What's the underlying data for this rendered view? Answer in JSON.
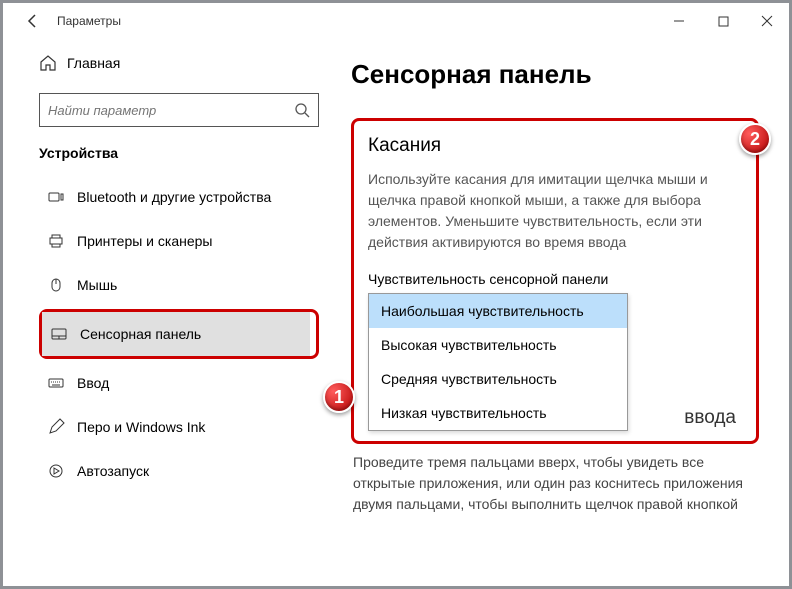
{
  "window": {
    "title": "Параметры"
  },
  "sidebar": {
    "home": "Главная",
    "search_placeholder": "Найти параметр",
    "category": "Устройства",
    "items": [
      {
        "label": "Bluetooth и другие устройства",
        "icon": "bluetooth-icon"
      },
      {
        "label": "Принтеры и сканеры",
        "icon": "printer-icon"
      },
      {
        "label": "Мышь",
        "icon": "mouse-icon"
      },
      {
        "label": "Сенсорная панель",
        "icon": "touchpad-icon"
      },
      {
        "label": "Ввод",
        "icon": "keyboard-icon"
      },
      {
        "label": "Перо и Windows Ink",
        "icon": "pen-icon"
      },
      {
        "label": "Автозапуск",
        "icon": "autoplay-icon"
      }
    ]
  },
  "main": {
    "page_title": "Сенсорная панель",
    "section_title": "Касания",
    "description": "Используйте касания для имитации щелчка мыши и щелчка правой кнопкой мыши, а также для выбора элементов. Уменьшите чувствительность, если эти действия активируются во время ввода",
    "dropdown_label": "Чувствительность сенсорной панели",
    "dropdown_options": [
      "Наибольшая чувствительность",
      "Высокая чувствительность",
      "Средняя чувствительность",
      "Низкая чувствительность"
    ],
    "after_section_frag": "ввода",
    "after_text": "Проведите тремя пальцами вверх, чтобы увидеть все открытые приложения, или один раз коснитесь приложения двумя пальцами, чтобы выполнить щелчок правой кнопкой"
  },
  "annotations": {
    "badge1": "1",
    "badge2": "2"
  }
}
